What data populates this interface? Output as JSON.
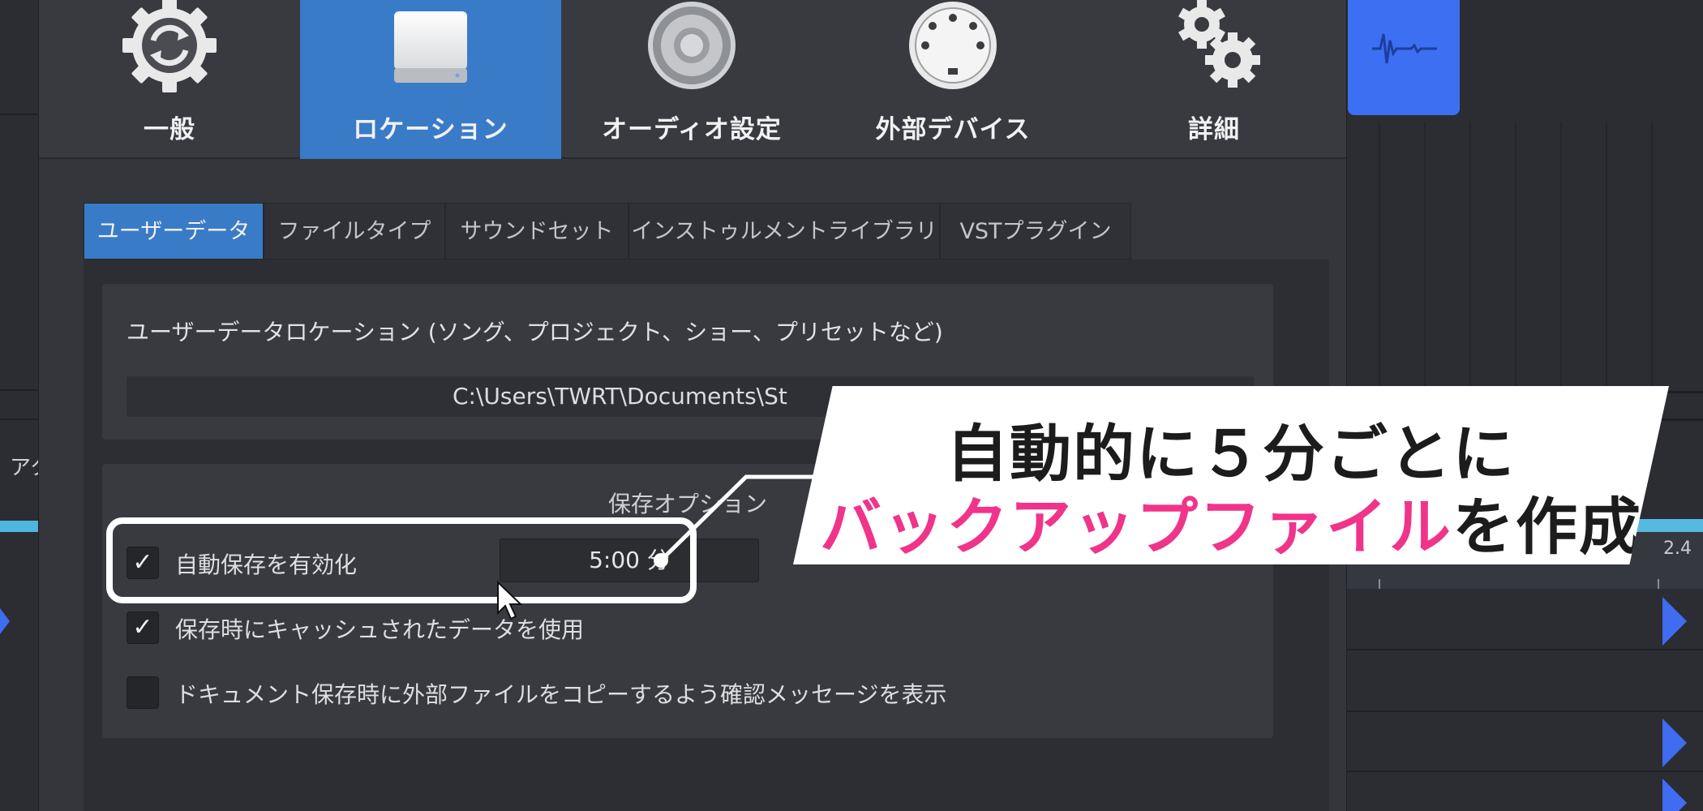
{
  "categories": [
    {
      "label": "一般",
      "icon": "sync-gear-icon"
    },
    {
      "label": "ロケーション",
      "icon": "drive-icon",
      "active": true
    },
    {
      "label": "オーディオ設定",
      "icon": "speaker-icon"
    },
    {
      "label": "外部デバイス",
      "icon": "midi-port-icon"
    },
    {
      "label": "詳細",
      "icon": "gears-icon"
    }
  ],
  "tabs": [
    {
      "label": "ユーザーデータ",
      "active": true
    },
    {
      "label": "ファイルタイプ"
    },
    {
      "label": "サウンドセット"
    },
    {
      "label": "インストゥルメントライブラリ"
    },
    {
      "label": "VSTプラグイン"
    }
  ],
  "user_data": {
    "title": "ユーザーデータロケーション (ソング、プロジェクト、ショー、プリセットなど)",
    "path": "C:\\Users\\TWRT\\Documents\\St"
  },
  "save_options": {
    "title": "保存オプション",
    "autosave": {
      "label": "自動保存を有効化",
      "checked": true,
      "interval": "5:00 分"
    },
    "use_cache": {
      "label": "保存時にキャッシュされたデータを使用",
      "checked": true
    },
    "confirm_copy": {
      "label": "ドキュメント保存時に外部ファイルをコピーするよう確認メッセージを表示",
      "checked": false
    }
  },
  "background": {
    "left_label": "アク",
    "ruler_number": "2.4"
  },
  "annotation": {
    "line1": "自動的に５分ごとに",
    "line2_highlight": "バックアップファイル",
    "line2_rest": "を作成"
  },
  "colors": {
    "accent": "#3a7bc8",
    "clip": "#3d6ff2",
    "highlight_text": "#f0348a"
  }
}
